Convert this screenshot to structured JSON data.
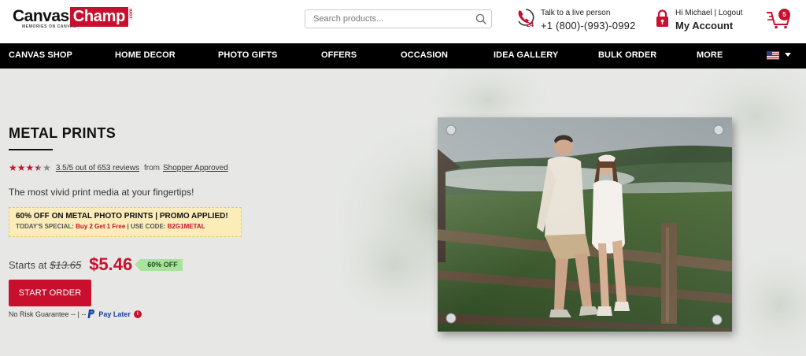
{
  "header": {
    "logo_main": "Canvas",
    "logo_accent": "Champ",
    "logo_suffix": ".com",
    "logo_tagline": "MEMORIES ON CANVAS",
    "search_placeholder": "Search products...",
    "phone_label": "Talk to a live person",
    "phone_number": "+1 (800)-(993)-0992",
    "phone_badge": "24",
    "greeting": "Hi Michael | Logout",
    "account_label": "My Account",
    "cart_count": "5"
  },
  "nav": {
    "items": [
      "CANVAS SHOP",
      "HOME DECOR",
      "PHOTO GIFTS",
      "OFFERS",
      "OCCASION",
      "IDEA GALLERY",
      "BULK ORDER",
      "MORE"
    ]
  },
  "hero": {
    "title": "METAL PRINTS",
    "rating_value": 3.5,
    "rating_max": 5,
    "rating_text": "3.5/5 out of 653 reviews",
    "rating_from": "from",
    "rating_source": "Shopper Approved",
    "tagline": "The most vivid print media at your fingertips!",
    "promo_line1": "60% OFF ON METAL PHOTO PRINTS | PROMO APPLIED!",
    "promo_special": "TODAY'S SPECIAL:",
    "promo_deal": "Buy 2 Get 1 Free",
    "promo_code_label": "| USE CODE:",
    "promo_code": "B2G1METAL",
    "starts_label": "Starts at",
    "old_price": "$13.65",
    "new_price": "$5.46",
    "discount_badge": "60% OFF",
    "cta_label": "START ORDER",
    "guarantee_text": "No Risk Guarantee -- | --",
    "pay_later": "Pay Later",
    "info_glyph": "i"
  },
  "colors": {
    "brand_red": "#c8102e",
    "nav_bg": "#000000",
    "promo_bg": "#fbecb8",
    "badge_green": "#a8e29b"
  }
}
